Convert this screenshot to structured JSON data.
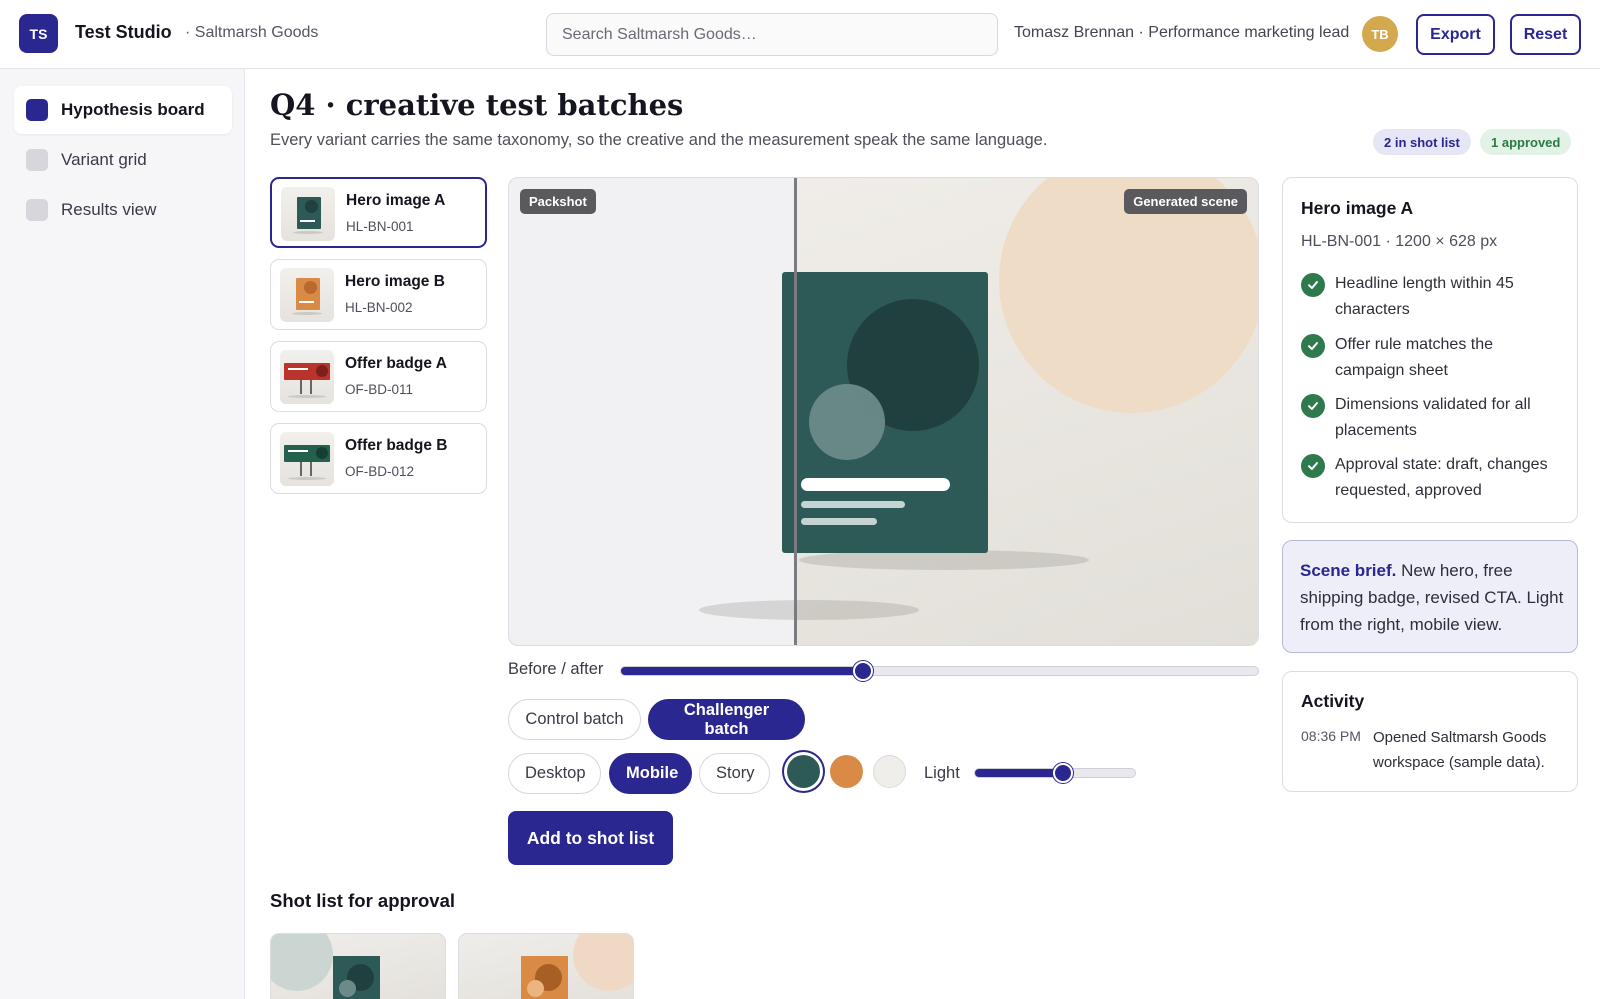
{
  "app": {
    "logo_initials": "TS",
    "name": "Test Studio",
    "workspace": "· Saltmarsh Goods"
  },
  "search": {
    "placeholder": "Search Saltmarsh Goods…",
    "value": ""
  },
  "user": {
    "line": "Tomasz Brennan · Performance marketing lead",
    "initials": "TB",
    "avatar_color": "#d4a84d"
  },
  "toolbar": {
    "export_label": "Export",
    "reset_label": "Reset"
  },
  "sidebar": {
    "items": [
      {
        "label": "Hypothesis board",
        "active": true
      },
      {
        "label": "Variant grid",
        "active": false
      },
      {
        "label": "Results view",
        "active": false
      }
    ]
  },
  "header": {
    "title": "Q4 · creative test batches",
    "subtitle": "Every variant carries the same taxonomy, so the creative and the measurement speak the same language.",
    "badge_shot_list": "2 in shot list",
    "badge_approved": "1 approved"
  },
  "variants": [
    {
      "name": "Hero image A",
      "code": "HL-BN-001",
      "kind": "hero",
      "color": "#2d5a57"
    },
    {
      "name": "Hero image B",
      "code": "HL-BN-002",
      "kind": "hero",
      "color": "#d98a44"
    },
    {
      "name": "Offer badge A",
      "code": "OF-BD-011",
      "kind": "badge",
      "color": "#b8342c"
    },
    {
      "name": "Offer badge B",
      "code": "OF-BD-012",
      "kind": "badge",
      "color": "#24604e"
    }
  ],
  "stage": {
    "tag_left": "Packshot",
    "tag_right": "Generated scene",
    "before_after_label": "Before / after",
    "before_after_value": 0.38
  },
  "batches": {
    "control": "Control batch",
    "challenger": "Challenger batch",
    "selected": "challenger"
  },
  "views": {
    "desktop": "Desktop",
    "mobile": "Mobile",
    "story": "Story",
    "selected": "mobile"
  },
  "swatches": [
    {
      "name": "teal",
      "color": "#2d5a57",
      "selected": true
    },
    {
      "name": "orange",
      "color": "#d98a44",
      "selected": false
    },
    {
      "name": "off-white",
      "color": "#efeeea",
      "selected": false
    }
  ],
  "light": {
    "label": "Light",
    "value": 0.55
  },
  "actions": {
    "add_to_shot_list": "Add to shot list"
  },
  "shot_list": {
    "title": "Shot list for approval",
    "items": [
      {
        "color": "#2d5a57",
        "accent": "#cbd6d2"
      },
      {
        "color": "#d98a44",
        "accent": "#f0d9c4"
      }
    ]
  },
  "detail": {
    "name": "Hero image A",
    "meta": "HL-BN-001 · 1200 × 628 px",
    "checks": [
      "Headline length within 45 characters",
      "Offer rule matches the campaign sheet",
      "Dimensions validated for all placements",
      "Approval state: draft, changes requested, approved"
    ]
  },
  "brief": {
    "lead": "Scene brief.",
    "text": " New hero, free shipping badge, revised CTA. Light from the right, mobile view."
  },
  "activity": {
    "title": "Activity",
    "entries": [
      {
        "time": "08:36 PM",
        "text": "Opened Saltmarsh Goods workspace (sample data)."
      }
    ]
  },
  "colors": {
    "accent": "#2a2790",
    "success": "#2f7a4c"
  }
}
